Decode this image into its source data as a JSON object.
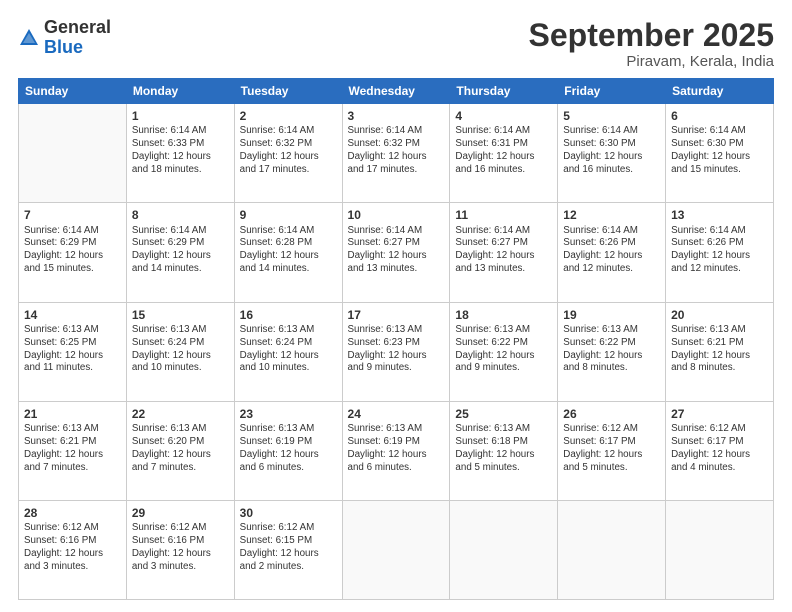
{
  "logo": {
    "general": "General",
    "blue": "Blue"
  },
  "header": {
    "month": "September 2025",
    "location": "Piravam, Kerala, India"
  },
  "weekdays": [
    "Sunday",
    "Monday",
    "Tuesday",
    "Wednesday",
    "Thursday",
    "Friday",
    "Saturday"
  ],
  "weeks": [
    [
      {
        "day": "",
        "info": ""
      },
      {
        "day": "1",
        "info": "Sunrise: 6:14 AM\nSunset: 6:33 PM\nDaylight: 12 hours\nand 18 minutes."
      },
      {
        "day": "2",
        "info": "Sunrise: 6:14 AM\nSunset: 6:32 PM\nDaylight: 12 hours\nand 17 minutes."
      },
      {
        "day": "3",
        "info": "Sunrise: 6:14 AM\nSunset: 6:32 PM\nDaylight: 12 hours\nand 17 minutes."
      },
      {
        "day": "4",
        "info": "Sunrise: 6:14 AM\nSunset: 6:31 PM\nDaylight: 12 hours\nand 16 minutes."
      },
      {
        "day": "5",
        "info": "Sunrise: 6:14 AM\nSunset: 6:30 PM\nDaylight: 12 hours\nand 16 minutes."
      },
      {
        "day": "6",
        "info": "Sunrise: 6:14 AM\nSunset: 6:30 PM\nDaylight: 12 hours\nand 15 minutes."
      }
    ],
    [
      {
        "day": "7",
        "info": "Sunrise: 6:14 AM\nSunset: 6:29 PM\nDaylight: 12 hours\nand 15 minutes."
      },
      {
        "day": "8",
        "info": "Sunrise: 6:14 AM\nSunset: 6:29 PM\nDaylight: 12 hours\nand 14 minutes."
      },
      {
        "day": "9",
        "info": "Sunrise: 6:14 AM\nSunset: 6:28 PM\nDaylight: 12 hours\nand 14 minutes."
      },
      {
        "day": "10",
        "info": "Sunrise: 6:14 AM\nSunset: 6:27 PM\nDaylight: 12 hours\nand 13 minutes."
      },
      {
        "day": "11",
        "info": "Sunrise: 6:14 AM\nSunset: 6:27 PM\nDaylight: 12 hours\nand 13 minutes."
      },
      {
        "day": "12",
        "info": "Sunrise: 6:14 AM\nSunset: 6:26 PM\nDaylight: 12 hours\nand 12 minutes."
      },
      {
        "day": "13",
        "info": "Sunrise: 6:14 AM\nSunset: 6:26 PM\nDaylight: 12 hours\nand 12 minutes."
      }
    ],
    [
      {
        "day": "14",
        "info": "Sunrise: 6:13 AM\nSunset: 6:25 PM\nDaylight: 12 hours\nand 11 minutes."
      },
      {
        "day": "15",
        "info": "Sunrise: 6:13 AM\nSunset: 6:24 PM\nDaylight: 12 hours\nand 10 minutes."
      },
      {
        "day": "16",
        "info": "Sunrise: 6:13 AM\nSunset: 6:24 PM\nDaylight: 12 hours\nand 10 minutes."
      },
      {
        "day": "17",
        "info": "Sunrise: 6:13 AM\nSunset: 6:23 PM\nDaylight: 12 hours\nand 9 minutes."
      },
      {
        "day": "18",
        "info": "Sunrise: 6:13 AM\nSunset: 6:22 PM\nDaylight: 12 hours\nand 9 minutes."
      },
      {
        "day": "19",
        "info": "Sunrise: 6:13 AM\nSunset: 6:22 PM\nDaylight: 12 hours\nand 8 minutes."
      },
      {
        "day": "20",
        "info": "Sunrise: 6:13 AM\nSunset: 6:21 PM\nDaylight: 12 hours\nand 8 minutes."
      }
    ],
    [
      {
        "day": "21",
        "info": "Sunrise: 6:13 AM\nSunset: 6:21 PM\nDaylight: 12 hours\nand 7 minutes."
      },
      {
        "day": "22",
        "info": "Sunrise: 6:13 AM\nSunset: 6:20 PM\nDaylight: 12 hours\nand 7 minutes."
      },
      {
        "day": "23",
        "info": "Sunrise: 6:13 AM\nSunset: 6:19 PM\nDaylight: 12 hours\nand 6 minutes."
      },
      {
        "day": "24",
        "info": "Sunrise: 6:13 AM\nSunset: 6:19 PM\nDaylight: 12 hours\nand 6 minutes."
      },
      {
        "day": "25",
        "info": "Sunrise: 6:13 AM\nSunset: 6:18 PM\nDaylight: 12 hours\nand 5 minutes."
      },
      {
        "day": "26",
        "info": "Sunrise: 6:12 AM\nSunset: 6:17 PM\nDaylight: 12 hours\nand 5 minutes."
      },
      {
        "day": "27",
        "info": "Sunrise: 6:12 AM\nSunset: 6:17 PM\nDaylight: 12 hours\nand 4 minutes."
      }
    ],
    [
      {
        "day": "28",
        "info": "Sunrise: 6:12 AM\nSunset: 6:16 PM\nDaylight: 12 hours\nand 3 minutes."
      },
      {
        "day": "29",
        "info": "Sunrise: 6:12 AM\nSunset: 6:16 PM\nDaylight: 12 hours\nand 3 minutes."
      },
      {
        "day": "30",
        "info": "Sunrise: 6:12 AM\nSunset: 6:15 PM\nDaylight: 12 hours\nand 2 minutes."
      },
      {
        "day": "",
        "info": ""
      },
      {
        "day": "",
        "info": ""
      },
      {
        "day": "",
        "info": ""
      },
      {
        "day": "",
        "info": ""
      }
    ]
  ]
}
